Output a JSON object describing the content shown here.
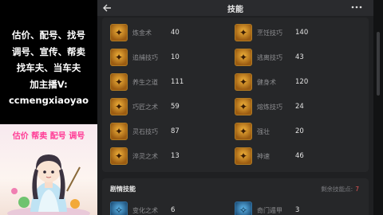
{
  "promo": {
    "lines": [
      "估价、配号、找号",
      "调号、宣传、帮卖",
      "找车夫、当车夫",
      "加主播V:",
      "ccmengxiaoyao"
    ],
    "banner": "估价 帮卖 配号 调号"
  },
  "header": {
    "back_icon": "back-arrow-icon",
    "title": "技能",
    "more_icon": "more-dots-icon"
  },
  "skills": [
    {
      "name": "炼金术",
      "level": "40",
      "icon": "alchemy-icon"
    },
    {
      "name": "烹饪技巧",
      "level": "140",
      "icon": "cooking-icon"
    },
    {
      "name": "追捕技巧",
      "level": "10",
      "icon": "pursuit-icon"
    },
    {
      "name": "逃离技巧",
      "level": "43",
      "icon": "escape-icon"
    },
    {
      "name": "养生之道",
      "level": "111",
      "icon": "health-icon"
    },
    {
      "name": "健身术",
      "level": "120",
      "icon": "fitness-icon"
    },
    {
      "name": "巧匠之术",
      "level": "59",
      "icon": "craftsman-icon"
    },
    {
      "name": "熔炼技巧",
      "level": "24",
      "icon": "smelting-icon"
    },
    {
      "name": "灵石技巧",
      "level": "87",
      "icon": "spirit-stone-icon"
    },
    {
      "name": "强壮",
      "level": "20",
      "icon": "strength-icon"
    },
    {
      "name": "淬灵之术",
      "level": "13",
      "icon": "quench-icon"
    },
    {
      "name": "神速",
      "level": "46",
      "icon": "speed-icon"
    }
  ],
  "plot_section": {
    "title": "剧情技能",
    "points_label": "剩余技能点:",
    "points_value": "7",
    "skills": [
      {
        "name": "变化之术",
        "level": "6",
        "icon": "transform-icon"
      },
      {
        "name": "奇门遁甲",
        "level": "3",
        "icon": "qimen-icon"
      }
    ]
  },
  "colors": {
    "accent_gold": "#f1b23a",
    "points_red": "#e25555",
    "background": "#1f2022"
  }
}
